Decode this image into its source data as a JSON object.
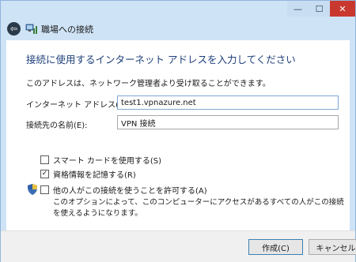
{
  "window": {
    "minimize": "—",
    "maximize": "☐",
    "close": "✕"
  },
  "nav": {
    "back": "⇦",
    "title": "職場への接続"
  },
  "main": {
    "heading": "接続に使用するインターネット アドレスを入力してください",
    "subtitle": "このアドレスは、ネットワーク管理者より受け取ることができます。",
    "address_label": "インターネット アドレス(I):",
    "address_value": "test1.vpnazure.net",
    "name_label": "接続先の名前(E):",
    "name_value": "VPN 接続"
  },
  "options": {
    "smartcard": {
      "label": "スマート カードを使用する(S)",
      "checked": false
    },
    "remember": {
      "label": "資格情報を記憶する(R)",
      "checked": true
    },
    "allow_others": {
      "label": "他の人がこの接続を使うことを許可する(A)",
      "checked": false
    },
    "allow_note": "このオプションによって、このコンピューターにアクセスがあるすべての人がこの接続を使えるようになります。"
  },
  "buttons": {
    "create": "作成(C)",
    "cancel": "キャンセル"
  },
  "colors": {
    "frame": "#cfe3f6",
    "heading": "#1e3f7a",
    "close_button": "#c9382f"
  }
}
